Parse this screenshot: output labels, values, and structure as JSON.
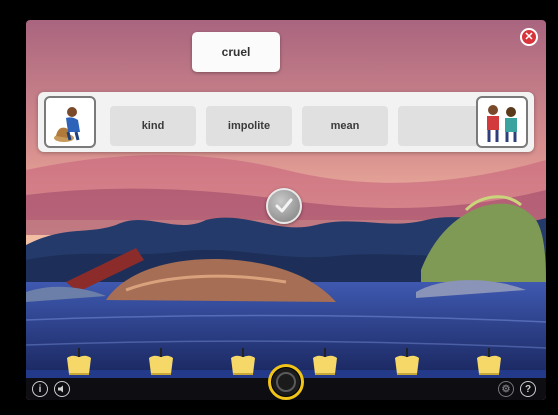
{
  "prompt": {
    "word": "cruel"
  },
  "answer_slots": [
    {
      "label": "kind"
    },
    {
      "label": "impolite"
    },
    {
      "label": "mean"
    },
    {
      "label": ""
    }
  ],
  "picture_cards": [
    {
      "icon": "person-with-dog-icon",
      "side": "left"
    },
    {
      "icon": "two-children-icon",
      "side": "right"
    }
  ],
  "controls": {
    "close_icon": "close-icon",
    "check_icon": "checkmark-icon",
    "info_icon": "info-icon",
    "sound_icon": "speaker-icon",
    "settings_icon": "settings-icon",
    "help_icon": "help-icon",
    "help_glyph": "?"
  },
  "candles": {
    "count": 6
  },
  "colors": {
    "sky_top": "#b86a82",
    "sky_glow": "#f3b6a0",
    "water": "#2a3f8f",
    "progress_ring": "#f0c419",
    "close_red": "#d8343c"
  }
}
